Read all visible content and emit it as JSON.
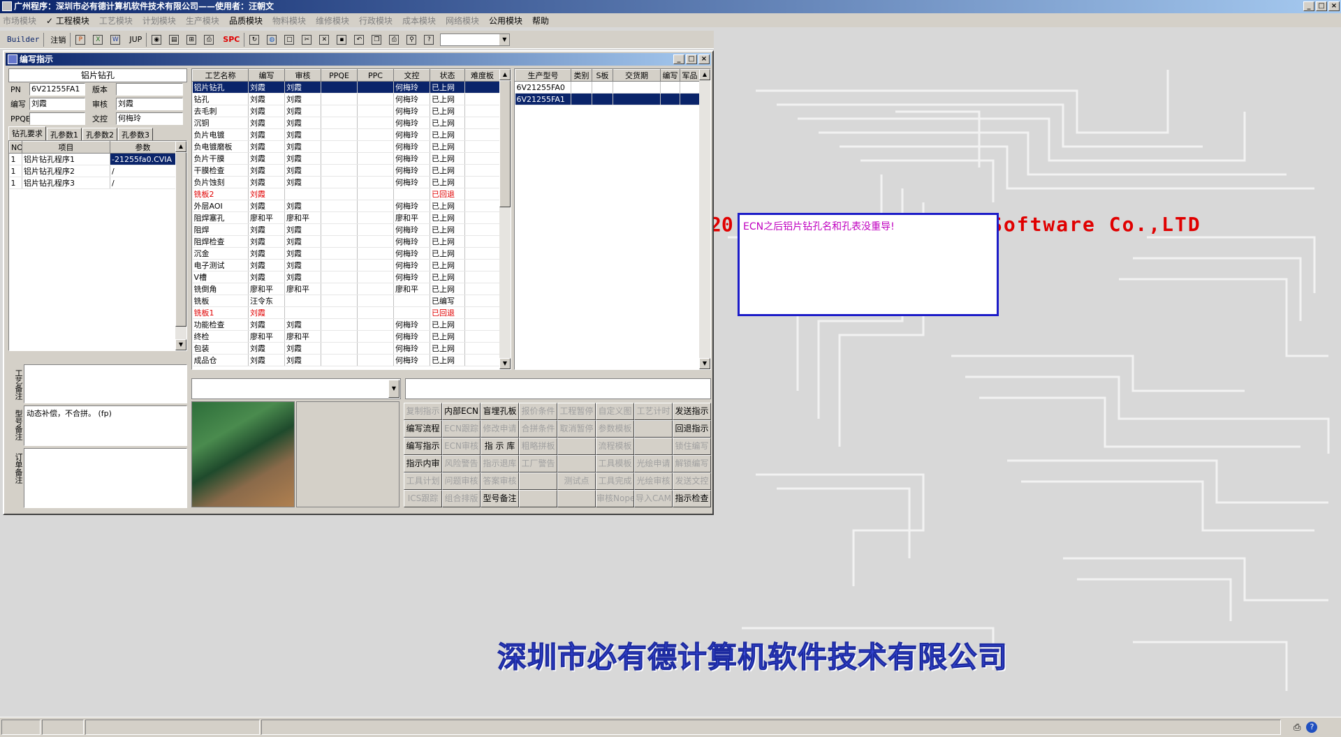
{
  "app": {
    "title": "广州程序：深圳市必有德计算机软件技术有限公司——使用者：汪朝文",
    "window_buttons": [
      "_",
      "□",
      "×"
    ]
  },
  "menu": [
    "市场模块",
    "✓ 工程模块",
    "工艺模块",
    "计划模块",
    "生产模块",
    "品质模块",
    "物料模块",
    "维修模块",
    "行政模块",
    "成本模块",
    "网络模块",
    "公用模块",
    "帮助"
  ],
  "toolbar": {
    "builder": "Builder",
    "logout": "注销",
    "jup": "JUP",
    "spc": "SPC"
  },
  "window": {
    "title": "编写指示",
    "buttons": [
      "_",
      "□",
      "×"
    ]
  },
  "left": {
    "header": "铝片钻孔",
    "pn_label": "PN",
    "pn_value": "6V21255FA1",
    "ver_label": "版本",
    "ver_value": "",
    "write_label": "编写",
    "write_value": "刘霞",
    "review_label": "审核",
    "review_value": "刘霞",
    "ppqe_label": "PPQE",
    "ppqe_value": "",
    "doc_label": "文控",
    "doc_value": "何梅玲",
    "tabs": [
      "钻孔要求",
      "孔参数1",
      "孔参数2",
      "孔参数3"
    ],
    "table_headers": [
      "NO",
      "项目",
      "参数"
    ],
    "rows": [
      [
        "1",
        "铝片钻孔程序1",
        "-21255fa0.CVIA"
      ],
      [
        "1",
        "铝片钻孔程序2",
        "/"
      ],
      [
        "1",
        "铝片钻孔程序3",
        "/"
      ]
    ],
    "memo1_label": "工艺备注",
    "memo1": "",
    "memo2_label": "型号备注",
    "memo2": "动态补偿，不合拼。 (fp)",
    "memo3_label": "订单备注",
    "memo3": ""
  },
  "process": {
    "headers": [
      "工艺名称",
      "编写",
      "审核",
      "PPQE",
      "PPC",
      "文控",
      "状态",
      "难度板"
    ],
    "rows": [
      {
        "c": [
          "铝片钻孔",
          "刘霞",
          "刘霞",
          "",
          "",
          "何梅玲",
          "已上网",
          ""
        ],
        "sel": true
      },
      {
        "c": [
          "钻孔",
          "刘霞",
          "刘霞",
          "",
          "",
          "何梅玲",
          "已上网",
          ""
        ]
      },
      {
        "c": [
          "去毛刺",
          "刘霞",
          "刘霞",
          "",
          "",
          "何梅玲",
          "已上网",
          ""
        ]
      },
      {
        "c": [
          "沉铜",
          "刘霞",
          "刘霞",
          "",
          "",
          "何梅玲",
          "已上网",
          ""
        ]
      },
      {
        "c": [
          "负片电镀",
          "刘霞",
          "刘霞",
          "",
          "",
          "何梅玲",
          "已上网",
          ""
        ]
      },
      {
        "c": [
          "负电镀磨板",
          "刘霞",
          "刘霞",
          "",
          "",
          "何梅玲",
          "已上网",
          ""
        ]
      },
      {
        "c": [
          "负片干膜",
          "刘霞",
          "刘霞",
          "",
          "",
          "何梅玲",
          "已上网",
          ""
        ]
      },
      {
        "c": [
          "干膜检查",
          "刘霞",
          "刘霞",
          "",
          "",
          "何梅玲",
          "已上网",
          ""
        ]
      },
      {
        "c": [
          "负片蚀刻",
          "刘霞",
          "刘霞",
          "",
          "",
          "何梅玲",
          "已上网",
          ""
        ]
      },
      {
        "c": [
          "铣板2",
          "刘霞",
          "",
          "",
          "",
          "",
          "已回退",
          ""
        ],
        "red": true
      },
      {
        "c": [
          "外层AOI",
          "刘霞",
          "刘霞",
          "",
          "",
          "何梅玲",
          "已上网",
          ""
        ]
      },
      {
        "c": [
          "阻焊塞孔",
          "廖和平",
          "廖和平",
          "",
          "",
          "廖和平",
          "已上网",
          ""
        ]
      },
      {
        "c": [
          "阻焊",
          "刘霞",
          "刘霞",
          "",
          "",
          "何梅玲",
          "已上网",
          ""
        ]
      },
      {
        "c": [
          "阻焊检查",
          "刘霞",
          "刘霞",
          "",
          "",
          "何梅玲",
          "已上网",
          ""
        ]
      },
      {
        "c": [
          "沉金",
          "刘霞",
          "刘霞",
          "",
          "",
          "何梅玲",
          "已上网",
          ""
        ]
      },
      {
        "c": [
          "电子测试",
          "刘霞",
          "刘霞",
          "",
          "",
          "何梅玲",
          "已上网",
          ""
        ]
      },
      {
        "c": [
          "V槽",
          "刘霞",
          "刘霞",
          "",
          "",
          "何梅玲",
          "已上网",
          ""
        ]
      },
      {
        "c": [
          "铣倒角",
          "廖和平",
          "廖和平",
          "",
          "",
          "廖和平",
          "已上网",
          ""
        ]
      },
      {
        "c": [
          "铣板",
          "汪令东",
          "",
          "",
          "",
          "",
          "已编写",
          ""
        ]
      },
      {
        "c": [
          "铣板1",
          "刘霞",
          "",
          "",
          "",
          "",
          "已回退",
          ""
        ],
        "red": true
      },
      {
        "c": [
          "功能检查",
          "刘霞",
          "刘霞",
          "",
          "",
          "何梅玲",
          "已上网",
          ""
        ]
      },
      {
        "c": [
          "终检",
          "廖和平",
          "廖和平",
          "",
          "",
          "何梅玲",
          "已上网",
          ""
        ]
      },
      {
        "c": [
          "包装",
          "刘霞",
          "刘霞",
          "",
          "",
          "何梅玲",
          "已上网",
          ""
        ]
      },
      {
        "c": [
          "成品仓",
          "刘霞",
          "刘霞",
          "",
          "",
          "何梅玲",
          "已上网",
          ""
        ]
      }
    ]
  },
  "models": {
    "headers": [
      "生产型号",
      "类别",
      "S板",
      "交货期",
      "编写",
      "军品"
    ],
    "rows": [
      {
        "c": [
          "6V21255FA0",
          "",
          "",
          "",
          "",
          ""
        ]
      },
      {
        "c": [
          "6V21255FA1",
          "",
          "",
          "",
          "",
          ""
        ],
        "sel": true
      }
    ]
  },
  "buttons": [
    {
      "t": "复制指示",
      "e": false
    },
    {
      "t": "内部ECN",
      "e": true
    },
    {
      "t": "盲埋孔板",
      "e": true
    },
    {
      "t": "报价条件",
      "e": false
    },
    {
      "t": "工程暂停",
      "e": false
    },
    {
      "t": "自定义图",
      "e": false
    },
    {
      "t": "工艺计时",
      "e": false
    },
    {
      "t": "发送指示",
      "e": true
    },
    {
      "t": "编写流程",
      "e": true
    },
    {
      "t": "ECN跟踪",
      "e": false
    },
    {
      "t": "修改申请",
      "e": false
    },
    {
      "t": "合拼条件",
      "e": false
    },
    {
      "t": "取消暂停",
      "e": false
    },
    {
      "t": "参数模板",
      "e": false
    },
    {
      "t": "",
      "e": false
    },
    {
      "t": "回退指示",
      "e": true
    },
    {
      "t": "编写指示",
      "e": true
    },
    {
      "t": "ECN审核",
      "e": false
    },
    {
      "t": "指 示 库",
      "e": true
    },
    {
      "t": "粗略拼板",
      "e": false
    },
    {
      "t": "",
      "e": false
    },
    {
      "t": "流程模板",
      "e": false
    },
    {
      "t": "",
      "e": false
    },
    {
      "t": "锁住编写",
      "e": false
    },
    {
      "t": "指示内审",
      "e": true
    },
    {
      "t": "风险警告",
      "e": false
    },
    {
      "t": "指示退库",
      "e": false
    },
    {
      "t": "工厂警告",
      "e": false
    },
    {
      "t": "",
      "e": false
    },
    {
      "t": "工具模板",
      "e": false
    },
    {
      "t": "光绘申请",
      "e": false
    },
    {
      "t": "解锁编写",
      "e": false
    },
    {
      "t": "工具计划",
      "e": false
    },
    {
      "t": "问题审核",
      "e": false
    },
    {
      "t": "答案审核",
      "e": false
    },
    {
      "t": "",
      "e": false
    },
    {
      "t": "测试点",
      "e": false
    },
    {
      "t": "工具完成",
      "e": false
    },
    {
      "t": "光绘审核",
      "e": false
    },
    {
      "t": "发送文控",
      "e": false
    },
    {
      "t": "ICS跟踪",
      "e": false
    },
    {
      "t": "组合排版",
      "e": false
    },
    {
      "t": "型号备注",
      "e": true
    },
    {
      "t": "",
      "e": false
    },
    {
      "t": "",
      "e": false
    },
    {
      "t": "审核Nope",
      "e": false
    },
    {
      "t": "导入CAM",
      "e": false
    },
    {
      "t": "指示检查",
      "e": true
    }
  ],
  "background": {
    "company_en_fragment": "20",
    "company_en": "Software Co.,LTD",
    "company_cn": "深圳市必有德计算机软件技术有限公司"
  },
  "message": {
    "text": "ECN之后铝片钻孔名和孔表没重导!"
  },
  "colors": {
    "selection": "#0a246a",
    "reverted": "#e00000",
    "message": "#c000c0",
    "frame": "#1c1cc8"
  }
}
